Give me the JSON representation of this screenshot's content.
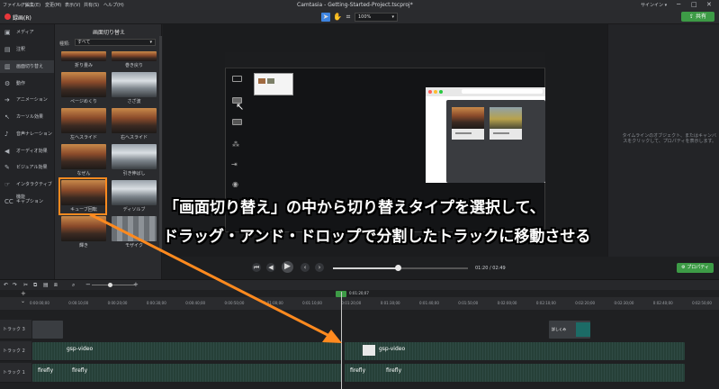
{
  "menubar": {
    "items": [
      "ファイル(F)",
      "編集(E)",
      "変更(M)",
      "表示(V)",
      "共有(S)",
      "ヘルプ(H)"
    ],
    "title": "Camtasia - Getting-Started-Project.tscproj*",
    "signin": "サインイン ▾",
    "minimize": "─",
    "maximize": "□",
    "close": "✕"
  },
  "toolbar": {
    "record_label": "録画(R)",
    "zoom": "100%",
    "share": "共有"
  },
  "sidebar": {
    "items": [
      "メディア",
      "注釈",
      "画面切り替え",
      "動作",
      "アニメーション",
      "カーソル効果",
      "音声ナレーション",
      "オーディオ効果",
      "ビジュアル効果",
      "インタラクティブ機能",
      "キャプション"
    ]
  },
  "panel": {
    "title": "画面切り替え",
    "type_label": "種類:",
    "type_value": "すべて",
    "thumbs": [
      {
        "label": "折り畳み"
      },
      {
        "label": "巻き戻り"
      },
      {
        "label": "ページめくり"
      },
      {
        "label": "さざ波"
      },
      {
        "label": "左ヘスライド"
      },
      {
        "label": "右ヘスライド"
      },
      {
        "label": "なぜん"
      },
      {
        "label": "引き伸ばし"
      },
      {
        "label": "キューブ回転"
      },
      {
        "label": "ディソルブ"
      },
      {
        "label": "輝き"
      },
      {
        "label": "モザイク"
      }
    ]
  },
  "props": {
    "hint": "タイムラインのオブジェクト、またはキャンバスをクリックして、プロパティを表示します。"
  },
  "captions": {
    "line1": "「画面切り替え」の中から切り替えタイプを選択して、",
    "line2": "ドラッグ・アンド・ドロップで分割したトラックに移動させる"
  },
  "playback": {
    "time": "01:20 / 02:49",
    "properties": "プロパティ"
  },
  "timeline": {
    "playhead_time": "0:01:20;07",
    "ticks": [
      "0:00:00;00",
      "0:00:10;00",
      "0:00:20;00",
      "0:00:30;00",
      "0:00:40;00",
      "0:00:50;00",
      "0:01:00;00",
      "0:01:10;00",
      "0:01:20;00",
      "0:01:30;00",
      "0:01:40;00",
      "0:01:50;00",
      "0:02:00;00",
      "0:02:10;00",
      "0:02:20;00",
      "0:02:30;00",
      "0:02:40;00",
      "0:02:50;00"
    ],
    "tracks": [
      "トラック 3",
      "トラック 2",
      "トラック 1"
    ],
    "clips": {
      "video1": "gsp-video",
      "video2": "gsp-video",
      "audio1": "firefly",
      "audio2": "firefly",
      "audio3": "firefly",
      "audio4": "firefly",
      "callout": "詳しくみ"
    }
  },
  "colors": {
    "accent_orange": "#ff8a1f",
    "share_green": "#3d9b46",
    "record_red": "#e8373b"
  }
}
